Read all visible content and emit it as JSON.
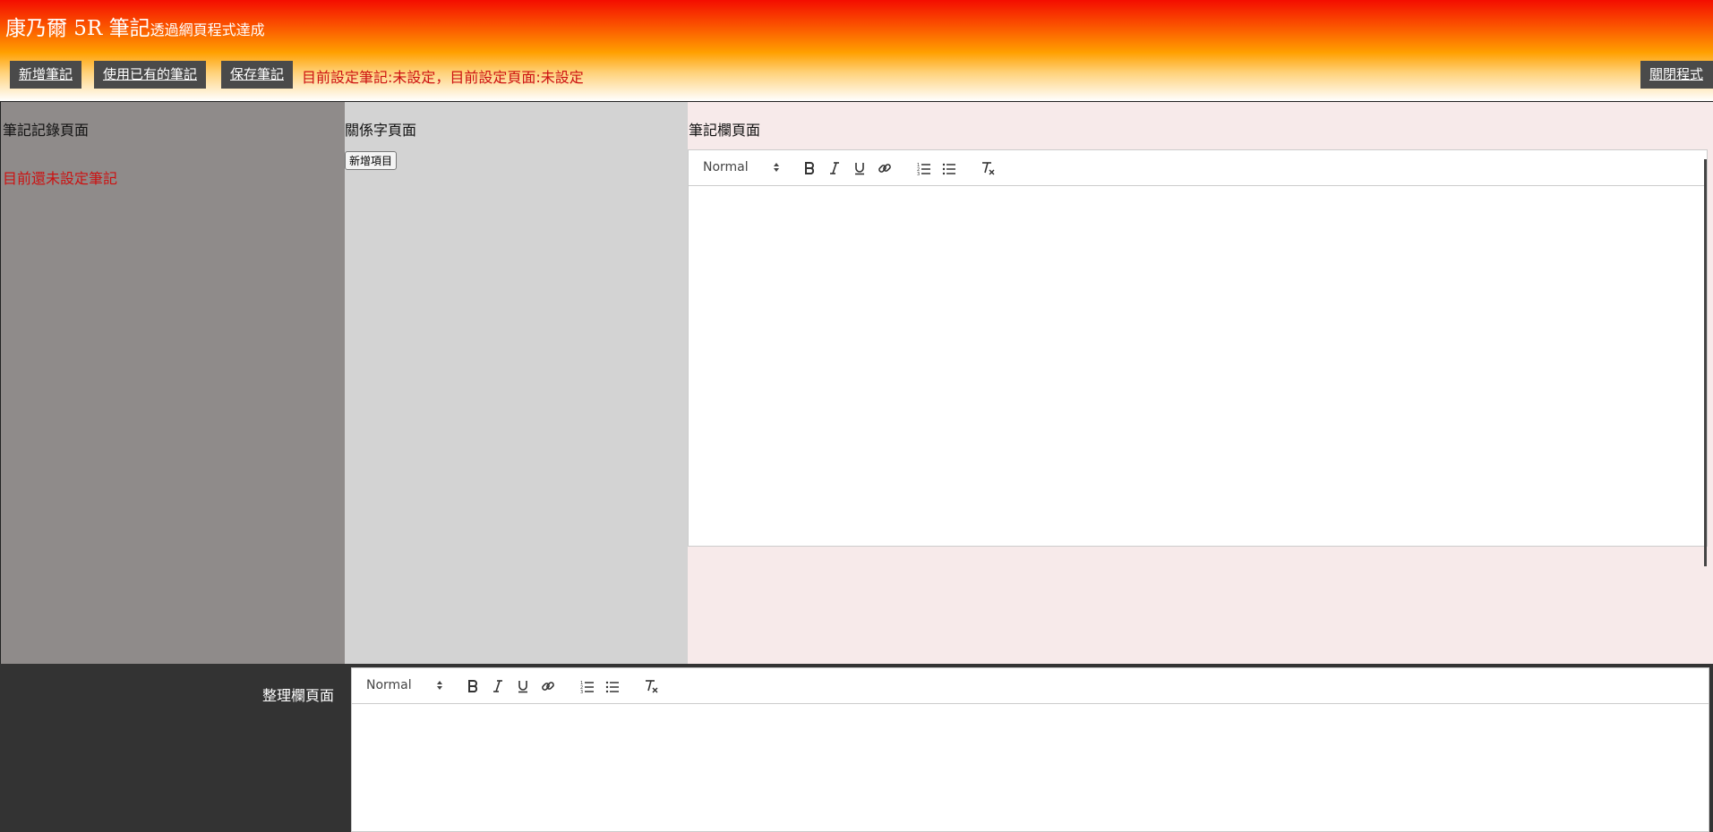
{
  "header": {
    "title_main": "康乃爾 5R 筆記",
    "title_sub": "透過網頁程式達成",
    "buttons": {
      "new_note": "新增筆記",
      "use_existing": "使用已有的筆記",
      "save_note": "保存筆記",
      "close_app": "關閉程式"
    },
    "status": "目前設定筆記:未設定，目前設定頁面:未設定"
  },
  "notes_panel": {
    "title": "筆記記錄頁面",
    "empty_message": "目前還未設定筆記"
  },
  "keywords_panel": {
    "title": "關係字頁面",
    "add_button": "新增項目"
  },
  "note_panel": {
    "title": "筆記欄頁面",
    "editor": {
      "format_select": "Normal"
    }
  },
  "summary_panel": {
    "title": "整理欄頁面",
    "editor": {
      "format_select": "Normal"
    }
  },
  "colors": {
    "header_top": "#f40d00",
    "header_mid": "#ffa000",
    "button_bg": "#4a4a4a",
    "status_text": "#cc1111",
    "notes_panel_bg": "#8f8b8a",
    "keywords_panel_bg": "#d3d3d3",
    "note_panel_bg": "#f7eaea",
    "bottom_bg": "#333333"
  },
  "toolbar_icons": [
    "format-select",
    "bold-icon",
    "italic-icon",
    "underline-icon",
    "link-icon",
    "ordered-list-icon",
    "bullet-list-icon",
    "clear-format-icon"
  ]
}
